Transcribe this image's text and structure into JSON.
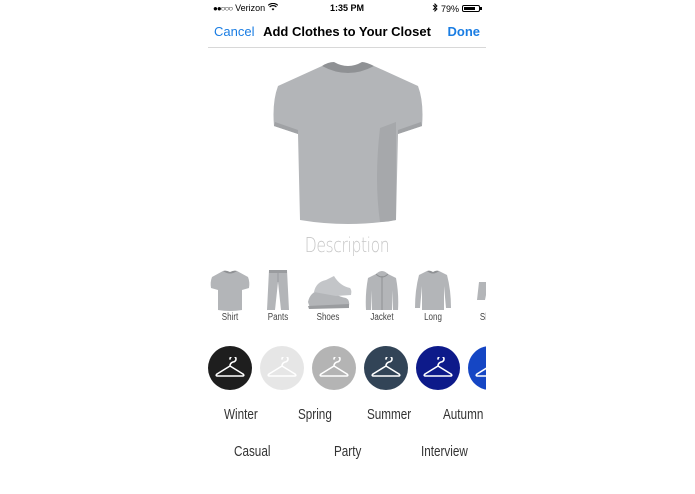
{
  "status_bar": {
    "signal_dots": "●●○○○",
    "carrier": "Verizon",
    "wifi_icon": "wifi-icon",
    "time": "1:35 PM",
    "bluetooth_icon": "bluetooth-icon",
    "battery_percent": "79%",
    "battery_level": 0.79
  },
  "nav": {
    "cancel_label": "Cancel",
    "title": "Add Clothes to Your Closet",
    "done_label": "Done",
    "accent_color": "#1a7de3"
  },
  "hero": {
    "icon": "tshirt-icon"
  },
  "description": {
    "placeholder": "Description"
  },
  "categories": [
    {
      "label": "Shirt",
      "icon": "shirt-icon"
    },
    {
      "label": "Pants",
      "icon": "pants-icon"
    },
    {
      "label": "Shoes",
      "icon": "shoes-icon"
    },
    {
      "label": "Jacket",
      "icon": "jacket-icon"
    },
    {
      "label": "Long",
      "icon": "long-sleeve-icon"
    },
    {
      "label": "Sho",
      "icon": "shorts-icon"
    }
  ],
  "colors": [
    {
      "hex": "#1e1e1e",
      "icon": "hanger-icon"
    },
    {
      "hex": "#e6e6e6",
      "icon": "hanger-icon"
    },
    {
      "hex": "#b4b4b4",
      "icon": "hanger-icon"
    },
    {
      "hex": "#324457",
      "icon": "hanger-icon"
    },
    {
      "hex": "#0d1a8a",
      "icon": "hanger-icon"
    },
    {
      "hex": "#1546c4",
      "icon": "hanger-icon"
    }
  ],
  "seasons": [
    "Winter",
    "Spring",
    "Summer",
    "Autumn"
  ],
  "occasions": [
    "Casual",
    "Party",
    "Interview"
  ]
}
